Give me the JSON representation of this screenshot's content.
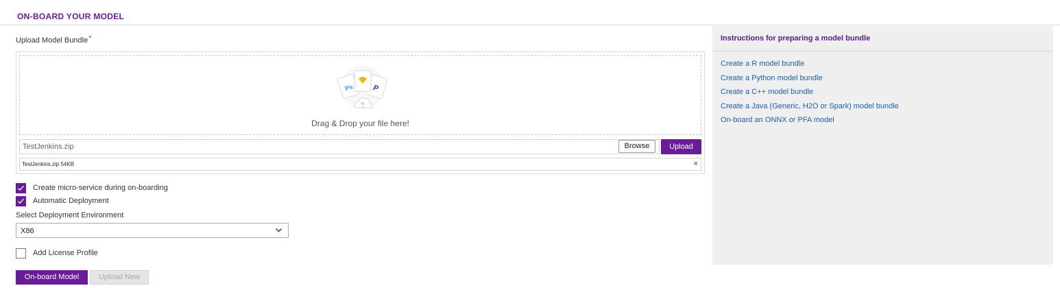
{
  "header": {
    "title": "ON-BOARD YOUR MODEL"
  },
  "upload": {
    "label": "Upload Model Bundle",
    "required_mark": "*",
    "drop_text": "Drag & Drop your file here!",
    "file_input_value": "TestJenkins.zip",
    "browse_label": "Browse",
    "upload_label": "Upload",
    "selected_file": "TestJenkins.zip 54KB",
    "remove_label": "×"
  },
  "options": {
    "microservice": {
      "label": "Create micro-service during on-boarding",
      "checked": true
    },
    "auto_deploy": {
      "label": "Automatic Deployment",
      "checked": true
    },
    "environment": {
      "label": "Select Deployment Environment",
      "value": "X86"
    },
    "license": {
      "label": "Add License Profile",
      "checked": false
    }
  },
  "actions": {
    "onboard_label": "On-board Model",
    "upload_new_label": "Upload New"
  },
  "instructions": {
    "title": "Instructions for preparing a model bundle",
    "links": [
      "Create a R model bundle",
      "Create a Python model bundle",
      "Create a C++ model bundle",
      "Create a Java (Generic, H2O or Spark) model bundle",
      "On-board an ONNX or PFA model"
    ]
  },
  "colors": {
    "accent": "#6a1b9a",
    "link": "#1e5fa8",
    "panel_bg": "#efefef"
  }
}
